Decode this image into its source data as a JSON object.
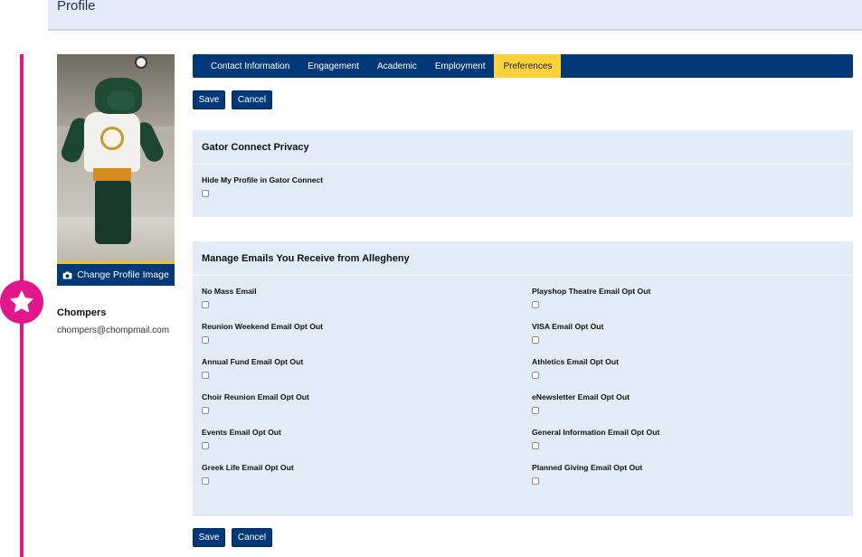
{
  "header": {
    "title": "Profile"
  },
  "profile": {
    "change_image_label": "Change Profile Image",
    "name": "Chompers",
    "email": "chompers@chompmail.com"
  },
  "tabs": [
    {
      "label": "Contact Information",
      "active": false
    },
    {
      "label": "Engagement",
      "active": false
    },
    {
      "label": "Academic",
      "active": false
    },
    {
      "label": "Employment",
      "active": false
    },
    {
      "label": "Preferences",
      "active": true
    }
  ],
  "actions": {
    "save_label": "Save",
    "cancel_label": "Cancel"
  },
  "privacy": {
    "title": "Gator Connect Privacy",
    "fields": [
      {
        "label": "Hide My Profile in Gator Connect",
        "checked": false
      }
    ]
  },
  "emails": {
    "title": "Manage Emails You Receive from Allegheny",
    "left": [
      {
        "label": "No Mass Email",
        "checked": false
      },
      {
        "label": "Reunion Weekend Email Opt Out",
        "checked": false
      },
      {
        "label": "Annual Fund Email Opt Out",
        "checked": false
      },
      {
        "label": "Choir Reunion Email Opt Out",
        "checked": false
      },
      {
        "label": "Events Email Opt Out",
        "checked": false
      },
      {
        "label": "Greek Life Email Opt Out",
        "checked": false
      }
    ],
    "right": [
      {
        "label": "Playshop Theatre Email Opt Out",
        "checked": false
      },
      {
        "label": "VISA Email Opt Out",
        "checked": false
      },
      {
        "label": "Athletics Email Opt Out",
        "checked": false
      },
      {
        "label": "eNewsletter Email Opt Out",
        "checked": false
      },
      {
        "label": "General Information Email Opt Out",
        "checked": false
      },
      {
        "label": "Planned Giving Email Opt Out",
        "checked": false
      }
    ]
  },
  "colors": {
    "navy": "#003878",
    "active_tab": "#ffd23a",
    "panel": "#e2ebf8",
    "timeline": "#e2158a"
  },
  "icons": {
    "timeline_badge": "star-icon",
    "change_image": "camera-icon"
  }
}
